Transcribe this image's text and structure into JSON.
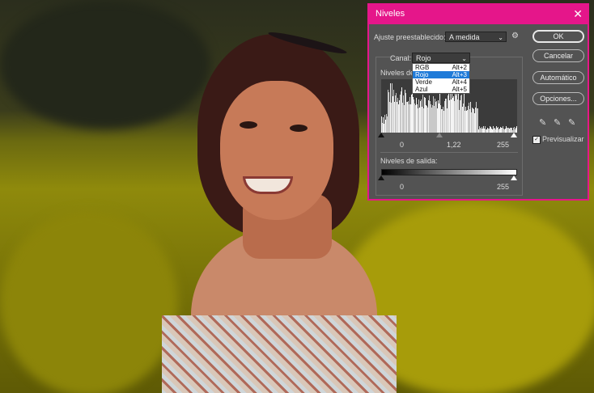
{
  "dialog": {
    "title": "Niveles",
    "preset_label": "Ajuste preestablecido:",
    "preset_value": "A medida",
    "channel_label": "Canal:",
    "channel_value": "Rojo",
    "channel_options": [
      {
        "label": "RGB",
        "shortcut": "Alt+2"
      },
      {
        "label": "Rojo",
        "shortcut": "Alt+3"
      },
      {
        "label": "Verde",
        "shortcut": "Alt+4"
      },
      {
        "label": "Azul",
        "shortcut": "Alt+5"
      }
    ],
    "input_levels_label": "Niveles de",
    "input_black": "0",
    "input_gamma": "1,22",
    "input_white": "255",
    "output_levels_label": "Niveles de salida:",
    "output_black": "0",
    "output_white": "255",
    "buttons": {
      "ok": "OK",
      "cancel": "Cancelar",
      "auto": "Automático",
      "options": "Opciones..."
    },
    "preview_label": "Previsualizar",
    "preview_checked": true
  },
  "colors": {
    "accent": "#e5168a",
    "dialog_bg": "#535353",
    "menu_selection": "#1e7ad8"
  },
  "icons": {
    "close": "close-icon",
    "gear": "gear-icon",
    "droppers": [
      "black-eyedropper-icon",
      "gray-eyedropper-icon",
      "white-eyedropper-icon"
    ]
  }
}
